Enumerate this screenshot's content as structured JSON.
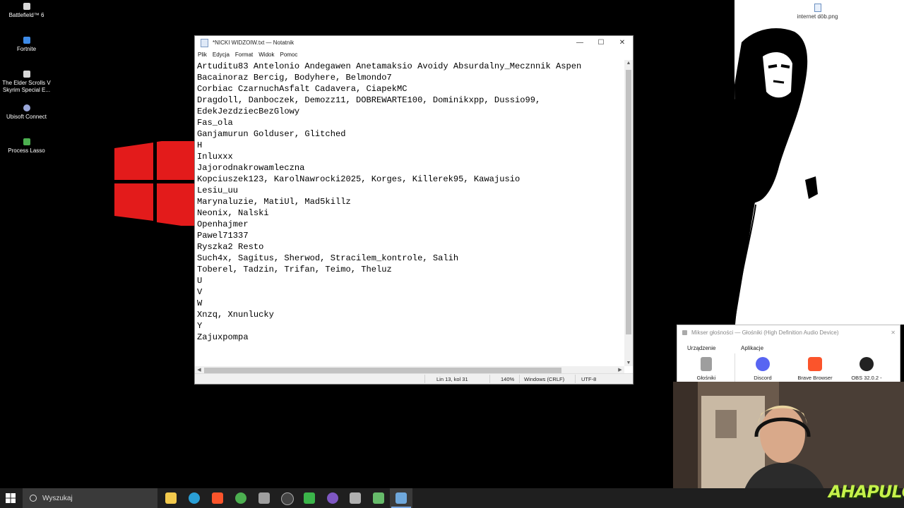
{
  "desktop": {
    "icons": [
      {
        "label": "Battlefield™ 6",
        "icon": "battlefield-icon",
        "color": "#d9d9d9"
      },
      {
        "label": "Fortnite",
        "icon": "fortnite-icon",
        "color": "#3d8be8"
      },
      {
        "label": "The Elder Scrolls V Skyrim Special E...",
        "icon": "skyrim-icon",
        "color": "#d9d9d9"
      },
      {
        "label": "Ubisoft Connect",
        "icon": "ubisoft-icon",
        "color": "#9aa7d9"
      },
      {
        "label": "Process Lasso",
        "icon": "process-lasso-icon",
        "color": "#4caf50"
      }
    ],
    "file_label": "internet döb.png"
  },
  "notepad": {
    "title": "*NICKI WIDZOIW.txt — Notatnik",
    "menu": [
      "Plik",
      "Edycja",
      "Format",
      "Widok",
      "Pomoc"
    ],
    "lines": [
      "Artuditu83 Antelonio Andegawen Anetamaksio Avoidy Absurdalny_Mecznnik Aspen",
      "Bacainoraz Bercig, Bodyhere, Belmondo7",
      "Corbiac CzarnuchAsfalt Cadavera, CiapekMC",
      "Dragdoll, Danboczek, Demozz11, DOBREWARTE100, Dominikxpp, Dussio99,",
      "EdekJezdziecBezGlowy",
      "Fas_ola",
      "Ganjamurun Golduser, Glitched",
      "H",
      "Inluxxx",
      "Jajorodnakrowamleczna",
      "Kopciuszek123, KarolNawrocki2025, Korges, Killerek95, Kawajusio",
      "Lesiu_uu",
      "Marynaluzie, MatiUl, Mad5killz",
      "Neonix, Nalski",
      "Openhajmer",
      "Pawel71337",
      "Ryszka2 Resto",
      "Such4x, Sagitus, Sherwod, Stracilem_kontrole, Salih",
      "Toberel, Tadzin, Trifan, Teimo, Theluz",
      "U",
      "V",
      "W",
      "Xnzq, Xnunlucky",
      "Y",
      "Zajuxpompa"
    ],
    "status": {
      "position": "Lin 13, kol 31",
      "zoom": "140%",
      "line_ending": "Windows (CRLF)",
      "encoding": "UTF-8"
    }
  },
  "mixer": {
    "title": "Mikser głośności — Głośniki (High Definition Audio Device)",
    "device_header": "Urządzenie",
    "apps_header": "Aplikacje",
    "device": {
      "label": "Głośniki",
      "icon": "speaker-icon"
    },
    "apps": [
      {
        "label": "Discord",
        "icon": "discord-icon",
        "color": "#5865f2"
      },
      {
        "label": "Brave Browser",
        "icon": "brave-icon",
        "color": "#fb542b"
      },
      {
        "label": "OBS 32.0.2 -",
        "icon": "obs-icon",
        "color": "#222222"
      }
    ]
  },
  "taskbar": {
    "search_placeholder": "Wyszukaj",
    "apps": [
      {
        "name": "file-explorer",
        "color": "#f2c94c"
      },
      {
        "name": "edge",
        "color": "#2a9fd6"
      },
      {
        "name": "brave",
        "color": "#fb542b"
      },
      {
        "name": "chrome",
        "color": "#4caf50"
      },
      {
        "name": "app-gray",
        "color": "#9e9e9e"
      },
      {
        "name": "obs",
        "color": "#444444"
      },
      {
        "name": "app-green",
        "color": "#3bb54a"
      },
      {
        "name": "app-purple",
        "color": "#7e57c2"
      },
      {
        "name": "app-shield",
        "color": "#b0b0b0"
      },
      {
        "name": "app-multi",
        "color": "#66bb6a"
      },
      {
        "name": "notepad",
        "color": "#6fa8dc"
      }
    ]
  },
  "brand": "AHAPULCO"
}
